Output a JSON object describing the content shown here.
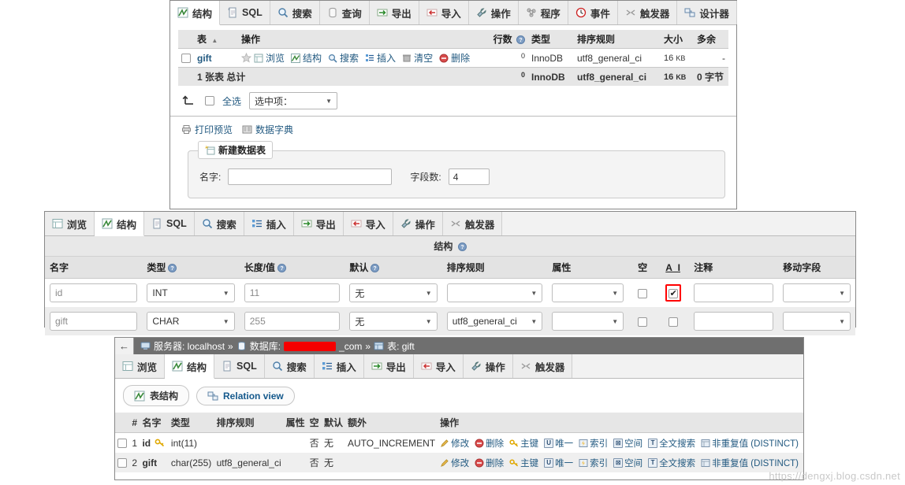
{
  "panel1": {
    "tabs": [
      {
        "label": "结构",
        "icon": "structure-icon",
        "active": true
      },
      {
        "label": "SQL",
        "icon": "sql-icon",
        "active": false
      },
      {
        "label": "搜索",
        "icon": "search-icon",
        "active": false
      },
      {
        "label": "查询",
        "icon": "query-icon",
        "active": false
      },
      {
        "label": "导出",
        "icon": "export-icon",
        "active": false
      },
      {
        "label": "导入",
        "icon": "import-icon",
        "active": false
      },
      {
        "label": "操作",
        "icon": "operations-icon",
        "active": false
      },
      {
        "label": "程序",
        "icon": "routines-icon",
        "active": false
      },
      {
        "label": "事件",
        "icon": "events-icon",
        "active": false
      },
      {
        "label": "触发器",
        "icon": "triggers-icon",
        "active": false
      },
      {
        "label": "设计器",
        "icon": "designer-icon",
        "active": false
      }
    ],
    "table_list": {
      "headers": [
        "表",
        "操作",
        "行数",
        "类型",
        "排序规则",
        "大小",
        "多余"
      ],
      "sort_indicator": "▲",
      "rows_help_icon": "help-icon",
      "row": {
        "name": "gift",
        "actions": [
          "浏览",
          "结构",
          "搜索",
          "插入",
          "清空",
          "删除"
        ],
        "action_icons": [
          "favorite-icon",
          "browse-icon",
          "structure-icon",
          "search-icon",
          "insert-icon",
          "empty-icon",
          "drop-icon"
        ],
        "rows": "0",
        "type": "InnoDB",
        "collation": "utf8_general_ci",
        "size": "16",
        "size_unit": "KB",
        "overhead": "-"
      },
      "total": {
        "label": "1 张表 总计",
        "rows": "0",
        "type": "InnoDB",
        "collation": "utf8_general_ci",
        "size": "16",
        "size_unit": "KB",
        "overhead": "0",
        "overhead_unit": "字节"
      }
    },
    "controls": {
      "check_all_icon": "arrow-up-icon",
      "check_all_label": "全选",
      "with_selected_label": "选中项：",
      "caret": "▼"
    },
    "links": [
      {
        "label": "打印预览",
        "icon": "print-icon"
      },
      {
        "label": "数据字典",
        "icon": "dictionary-icon"
      }
    ],
    "create_table": {
      "legend": "新建数据表",
      "legend_icon": "new-table-icon",
      "name_label": "名字:",
      "name_value": "",
      "cols_label": "字段数:",
      "cols_value": "4"
    }
  },
  "panel2": {
    "tabs": [
      {
        "label": "浏览",
        "icon": "browse-icon",
        "active": false
      },
      {
        "label": "结构",
        "icon": "structure-icon",
        "active": true
      },
      {
        "label": "SQL",
        "icon": "sql-icon",
        "active": false
      },
      {
        "label": "搜索",
        "icon": "search-icon",
        "active": false
      },
      {
        "label": "插入",
        "icon": "insert-icon",
        "active": false
      },
      {
        "label": "导出",
        "icon": "export-icon",
        "active": false
      },
      {
        "label": "导入",
        "icon": "import-icon",
        "active": false
      },
      {
        "label": "操作",
        "icon": "operations-icon",
        "active": false
      },
      {
        "label": "触发器",
        "icon": "triggers-icon",
        "active": false
      }
    ],
    "caption": "结构",
    "caption_help_icon": "help-icon",
    "headers": [
      "名字",
      "类型",
      "长度/值",
      "默认",
      "排序规则",
      "属性",
      "空",
      "A_I",
      "注释",
      "移动字段"
    ],
    "header_help": {
      "type": "help-icon",
      "length": "help-icon",
      "default": "help-icon"
    },
    "caret": "▼",
    "rows": [
      {
        "name": "id",
        "type": "INT",
        "length": "11",
        "default": "无",
        "collation": "",
        "attributes": "",
        "null_checked": false,
        "ai_checked": true,
        "ai_highlight": true,
        "comment": "",
        "move": ""
      },
      {
        "name": "gift",
        "type": "CHAR",
        "length": "255",
        "default": "无",
        "collation": "utf8_general_ci",
        "attributes": "",
        "null_checked": false,
        "ai_checked": false,
        "ai_highlight": false,
        "comment": "",
        "move": ""
      }
    ]
  },
  "panel3": {
    "breadcrumb": {
      "back_icon": "back-arrow-icon",
      "server_icon": "server-icon",
      "server_label": "服务器: localhost",
      "sep": "»",
      "db_icon": "database-icon",
      "db_label": "数据库:",
      "db_redacted": true,
      "db_suffix": "_com",
      "table_icon": "table-icon",
      "table_label": "表: gift"
    },
    "tabs": [
      {
        "label": "浏览",
        "icon": "browse-icon",
        "active": false
      },
      {
        "label": "结构",
        "icon": "structure-icon",
        "active": true
      },
      {
        "label": "SQL",
        "icon": "sql-icon",
        "active": false
      },
      {
        "label": "搜索",
        "icon": "search-icon",
        "active": false
      },
      {
        "label": "插入",
        "icon": "insert-icon",
        "active": false
      },
      {
        "label": "导出",
        "icon": "export-icon",
        "active": false
      },
      {
        "label": "导入",
        "icon": "import-icon",
        "active": false
      },
      {
        "label": "操作",
        "icon": "operations-icon",
        "active": false
      },
      {
        "label": "触发器",
        "icon": "triggers-icon",
        "active": false
      }
    ],
    "subtabs": [
      {
        "label": "表结构",
        "icon": "structure-icon",
        "active": true
      },
      {
        "label": "Relation view",
        "icon": "relation-icon",
        "active": false
      }
    ],
    "headers": [
      "#",
      "名字",
      "类型",
      "排序规则",
      "属性",
      "空",
      "默认",
      "额外",
      "操作"
    ],
    "rows": [
      {
        "num": "1",
        "name": "id",
        "key_icon": "primary-key-icon",
        "type": "int(11)",
        "collation": "",
        "attributes": "",
        "null": "否",
        "default": "无",
        "extra": "AUTO_INCREMENT",
        "actions": [
          "修改",
          "删除",
          "主键",
          "唯一",
          "索引",
          "空间",
          "全文搜索",
          "非重复值 (DISTINCT)"
        ]
      },
      {
        "num": "2",
        "name": "gift",
        "key_icon": "",
        "type": "char(255)",
        "collation": "utf8_general_ci",
        "attributes": "",
        "null": "否",
        "default": "无",
        "extra": "",
        "actions": [
          "修改",
          "删除",
          "主键",
          "唯一",
          "索引",
          "空间",
          "全文搜索",
          "非重复值 (DISTINCT)"
        ]
      }
    ]
  },
  "watermark": "https://dengxj.blog.csdn.net",
  "colors": {
    "link": "#235a81",
    "tab_active_bg": "#ffffff",
    "tab_bg": "#ededed",
    "header_bg": "#e6e6e6",
    "alt_row_bg": "#ededed",
    "highlight": "#ff0000",
    "crumb_bg": "#6f6f6f",
    "redact": "#f50000"
  }
}
